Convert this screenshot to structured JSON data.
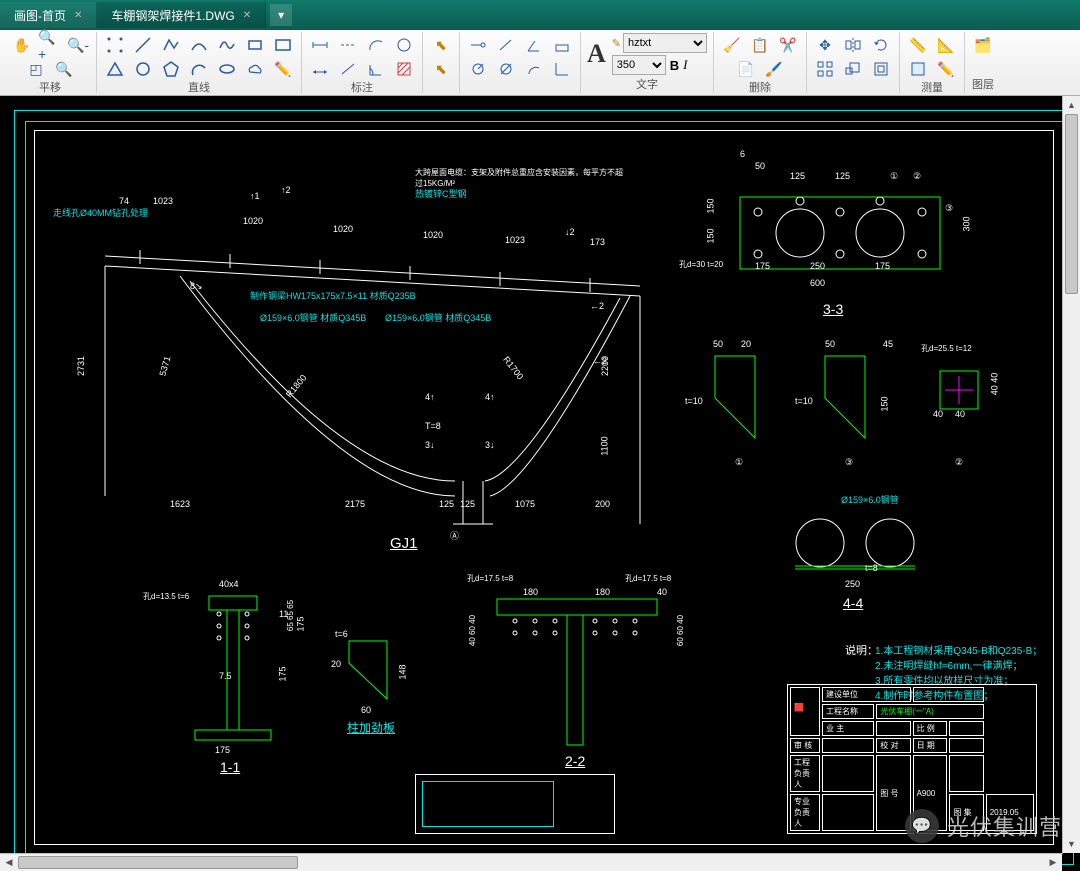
{
  "tabs": [
    {
      "label": "画图-首页"
    },
    {
      "label": "车棚钢架焊接件1.DWG"
    }
  ],
  "ribbon": {
    "g1": "平移",
    "g2": "直线",
    "g3": "",
    "g4": "标注",
    "g5": "文字",
    "g6": "删除",
    "g7": "",
    "g8": "测量",
    "g9": "图层",
    "font": "hztxt",
    "size": "350",
    "bold": "B",
    "italic": "I"
  },
  "drawing": {
    "main_title": "GJ1",
    "top_note": "大跨屋面电缆：支架及附件总重应含安装因素，每平方不超过15KG/M²",
    "note2": "热镀锌C型钢",
    "beam1": "制作钢梁HW175x175x7.5×11 材质Q235B",
    "beam2": "Ø159×6.0钢管 材质Q345B",
    "beam3": "Ø159×6.0钢管 材质Q345B",
    "left_note": "走线孔Ø40MM钻孔处理",
    "dims_top": [
      "74",
      "1023",
      "1020",
      "1020",
      "1020",
      "1023",
      "173"
    ],
    "dims_main": {
      "h": "2731",
      "h2": "5371",
      "w1": "1623",
      "w2": "2175",
      "w3": "125",
      "w4": "125",
      "w5": "1075",
      "w6": "200",
      "hr": "2200",
      "hr2": "1100",
      "r1": "R1800",
      "r2": "R1700",
      "t8": "T=8",
      "lbl_8": "8",
      "lbl_1": "1",
      "lbl_2": "2",
      "lbl_3": "3",
      "lbl_4": "4",
      "lbl_A": "A"
    },
    "sec33": {
      "title": "3-3",
      "d6": "6",
      "d50": "50",
      "d125a": "125",
      "d125b": "125",
      "d150a": "150",
      "d150b": "150",
      "d300": "300",
      "d175a": "175",
      "d250": "250",
      "d175b": "175",
      "d600": "600",
      "note": "孔d=30 t=20"
    },
    "parts": {
      "p1": "1",
      "p3": "3",
      "p2": "2",
      "d50": "50",
      "d20": "20",
      "d45": "45",
      "d150": "150",
      "t10a": "t=10",
      "t10b": "t=10",
      "note2": "孔d=25.5 t=12",
      "d40": "40",
      "d40b": "40",
      "d4040": "40 40"
    },
    "sec44": {
      "title": "4-4",
      "note": "Ø159×6.0钢管",
      "d250": "250",
      "t8": "t=8"
    },
    "sec11": {
      "title": "1-1",
      "d40": "40x4",
      "d175a": "175",
      "d175b": "175",
      "d175c": "175",
      "d75": "7.5",
      "d11": "11",
      "hole": "孔d=13.5 t=6",
      "d656565": "65 65 65"
    },
    "stiff": {
      "title": "柱加劲板",
      "t6": "t=6",
      "d20": "20",
      "d60": "60",
      "d148": "148"
    },
    "sec22": {
      "title": "2-2",
      "hole": "孔d=17.5 t=8",
      "hole2": "孔d=17.5 t=8",
      "d180a": "180",
      "d180b": "180",
      "d40": "40",
      "d606040": "40 60 40",
      "d406060": "60 60 40"
    },
    "notes": {
      "head": "说明：",
      "n1": "1.本工程钢材采用Q345-B和Q235-B；",
      "n2": "2.未注明焊缝hf=6mm,一律满焊；",
      "n3": "3.所有零件均以放样尺寸为准；",
      "n4": "4.制作时参考构件布置图；"
    },
    "titleblock": {
      "a": "建设单位",
      "b": "工程名称",
      "c": "光伏车棚(一\"A)",
      "d": "业 主",
      "e": "比 例",
      "f": "审 核",
      "g": "校 对",
      "h": "日 期",
      "i": "工程负责人",
      "j": "专业负责人",
      "k": "图 号",
      "l": "A900",
      "m": "图 集",
      "n": "2019.05"
    }
  },
  "watermark": "光伏集训营"
}
